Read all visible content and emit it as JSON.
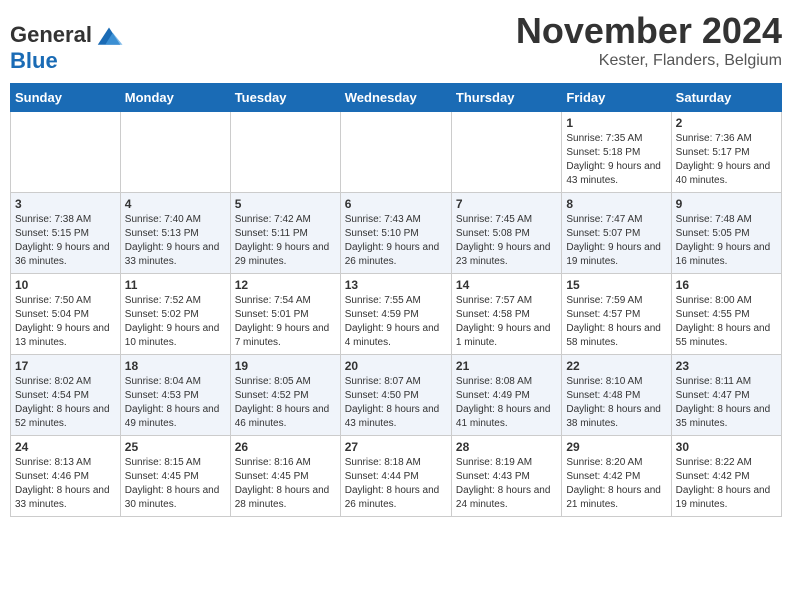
{
  "logo": {
    "text_general": "General",
    "text_blue": "Blue"
  },
  "header": {
    "month": "November 2024",
    "location": "Kester, Flanders, Belgium"
  },
  "days_of_week": [
    "Sunday",
    "Monday",
    "Tuesday",
    "Wednesday",
    "Thursday",
    "Friday",
    "Saturday"
  ],
  "weeks": [
    [
      {
        "day": "",
        "info": ""
      },
      {
        "day": "",
        "info": ""
      },
      {
        "day": "",
        "info": ""
      },
      {
        "day": "",
        "info": ""
      },
      {
        "day": "",
        "info": ""
      },
      {
        "day": "1",
        "info": "Sunrise: 7:35 AM\nSunset: 5:18 PM\nDaylight: 9 hours and 43 minutes."
      },
      {
        "day": "2",
        "info": "Sunrise: 7:36 AM\nSunset: 5:17 PM\nDaylight: 9 hours and 40 minutes."
      }
    ],
    [
      {
        "day": "3",
        "info": "Sunrise: 7:38 AM\nSunset: 5:15 PM\nDaylight: 9 hours and 36 minutes."
      },
      {
        "day": "4",
        "info": "Sunrise: 7:40 AM\nSunset: 5:13 PM\nDaylight: 9 hours and 33 minutes."
      },
      {
        "day": "5",
        "info": "Sunrise: 7:42 AM\nSunset: 5:11 PM\nDaylight: 9 hours and 29 minutes."
      },
      {
        "day": "6",
        "info": "Sunrise: 7:43 AM\nSunset: 5:10 PM\nDaylight: 9 hours and 26 minutes."
      },
      {
        "day": "7",
        "info": "Sunrise: 7:45 AM\nSunset: 5:08 PM\nDaylight: 9 hours and 23 minutes."
      },
      {
        "day": "8",
        "info": "Sunrise: 7:47 AM\nSunset: 5:07 PM\nDaylight: 9 hours and 19 minutes."
      },
      {
        "day": "9",
        "info": "Sunrise: 7:48 AM\nSunset: 5:05 PM\nDaylight: 9 hours and 16 minutes."
      }
    ],
    [
      {
        "day": "10",
        "info": "Sunrise: 7:50 AM\nSunset: 5:04 PM\nDaylight: 9 hours and 13 minutes."
      },
      {
        "day": "11",
        "info": "Sunrise: 7:52 AM\nSunset: 5:02 PM\nDaylight: 9 hours and 10 minutes."
      },
      {
        "day": "12",
        "info": "Sunrise: 7:54 AM\nSunset: 5:01 PM\nDaylight: 9 hours and 7 minutes."
      },
      {
        "day": "13",
        "info": "Sunrise: 7:55 AM\nSunset: 4:59 PM\nDaylight: 9 hours and 4 minutes."
      },
      {
        "day": "14",
        "info": "Sunrise: 7:57 AM\nSunset: 4:58 PM\nDaylight: 9 hours and 1 minute."
      },
      {
        "day": "15",
        "info": "Sunrise: 7:59 AM\nSunset: 4:57 PM\nDaylight: 8 hours and 58 minutes."
      },
      {
        "day": "16",
        "info": "Sunrise: 8:00 AM\nSunset: 4:55 PM\nDaylight: 8 hours and 55 minutes."
      }
    ],
    [
      {
        "day": "17",
        "info": "Sunrise: 8:02 AM\nSunset: 4:54 PM\nDaylight: 8 hours and 52 minutes."
      },
      {
        "day": "18",
        "info": "Sunrise: 8:04 AM\nSunset: 4:53 PM\nDaylight: 8 hours and 49 minutes."
      },
      {
        "day": "19",
        "info": "Sunrise: 8:05 AM\nSunset: 4:52 PM\nDaylight: 8 hours and 46 minutes."
      },
      {
        "day": "20",
        "info": "Sunrise: 8:07 AM\nSunset: 4:50 PM\nDaylight: 8 hours and 43 minutes."
      },
      {
        "day": "21",
        "info": "Sunrise: 8:08 AM\nSunset: 4:49 PM\nDaylight: 8 hours and 41 minutes."
      },
      {
        "day": "22",
        "info": "Sunrise: 8:10 AM\nSunset: 4:48 PM\nDaylight: 8 hours and 38 minutes."
      },
      {
        "day": "23",
        "info": "Sunrise: 8:11 AM\nSunset: 4:47 PM\nDaylight: 8 hours and 35 minutes."
      }
    ],
    [
      {
        "day": "24",
        "info": "Sunrise: 8:13 AM\nSunset: 4:46 PM\nDaylight: 8 hours and 33 minutes."
      },
      {
        "day": "25",
        "info": "Sunrise: 8:15 AM\nSunset: 4:45 PM\nDaylight: 8 hours and 30 minutes."
      },
      {
        "day": "26",
        "info": "Sunrise: 8:16 AM\nSunset: 4:45 PM\nDaylight: 8 hours and 28 minutes."
      },
      {
        "day": "27",
        "info": "Sunrise: 8:18 AM\nSunset: 4:44 PM\nDaylight: 8 hours and 26 minutes."
      },
      {
        "day": "28",
        "info": "Sunrise: 8:19 AM\nSunset: 4:43 PM\nDaylight: 8 hours and 24 minutes."
      },
      {
        "day": "29",
        "info": "Sunrise: 8:20 AM\nSunset: 4:42 PM\nDaylight: 8 hours and 21 minutes."
      },
      {
        "day": "30",
        "info": "Sunrise: 8:22 AM\nSunset: 4:42 PM\nDaylight: 8 hours and 19 minutes."
      }
    ]
  ]
}
